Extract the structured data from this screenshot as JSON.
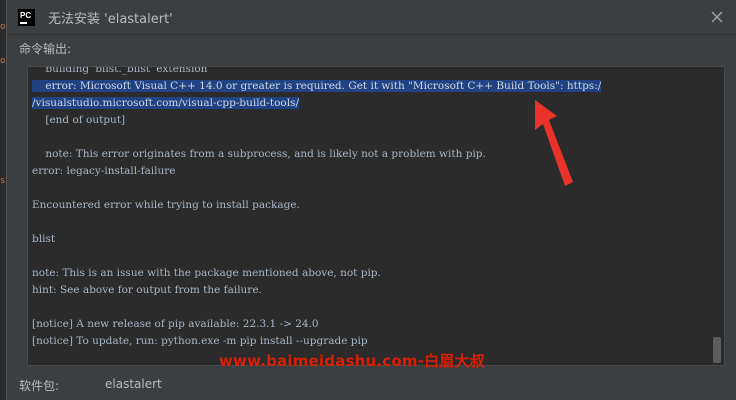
{
  "window": {
    "app_icon_text": "PC",
    "title": "无法安装 'elastalert'"
  },
  "labels": {
    "command_output": "命令输出:",
    "package": "软件包:",
    "package_value": "elastalert"
  },
  "console": {
    "lines": [
      "    building 'blist._blist' extension",
      "    error: Microsoft Visual C++ 14.0 or greater is required. Get it with \"Microsoft C++ Build Tools\": https:/",
      "/visualstudio.microsoft.com/visual-cpp-build-tools/",
      "    [end of output]",
      "",
      "    note: This error originates from a subprocess, and is likely not a problem with pip.",
      "error: legacy-install-failure",
      "",
      "Encountered error while trying to install package.",
      "",
      "blist",
      "",
      "note: This is an issue with the package mentioned above, not pip.",
      "hint: See above for output from the failure.",
      "",
      "[notice] A new release of pip available: 22.3.1 -> 24.0",
      "[notice] To update, run: python.exe -m pip install --upgrade pip"
    ]
  },
  "watermark": "www.baimeidashu.com-白眉大叔",
  "left_edge_glyphs": [
    "o",
    "o",
    "s"
  ],
  "colors": {
    "selection": "#214283",
    "arrow": "#e8322a",
    "watermark": "#d81e06"
  }
}
